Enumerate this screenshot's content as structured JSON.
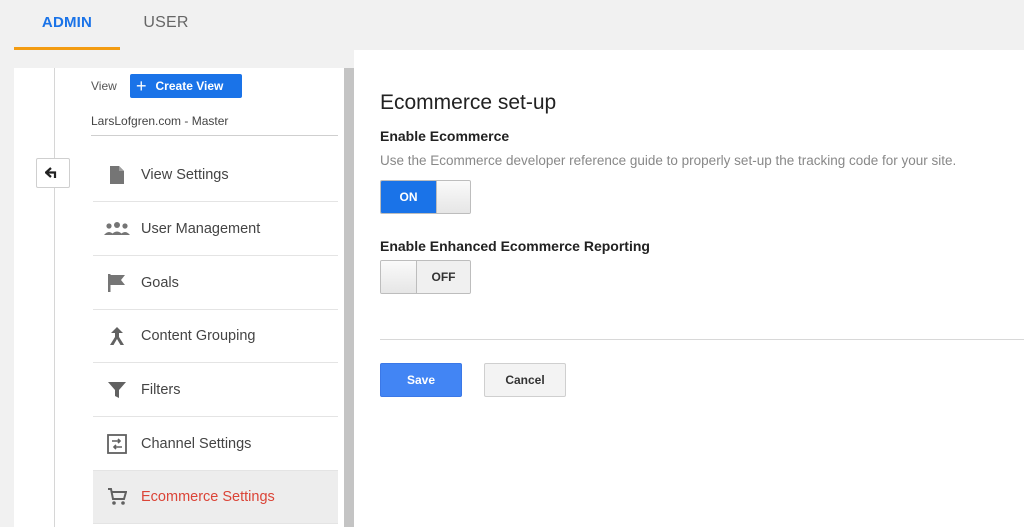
{
  "tabs": [
    {
      "label": "ADMIN",
      "active": true
    },
    {
      "label": "USER",
      "active": false
    }
  ],
  "sidebar": {
    "view_label": "View",
    "create_view_label": "Create View",
    "view_name": "LarsLofgren.com - Master",
    "items": [
      {
        "label": "View Settings",
        "icon": "document-icon"
      },
      {
        "label": "User Management",
        "icon": "users-icon"
      },
      {
        "label": "Goals",
        "icon": "flag-icon"
      },
      {
        "label": "Content Grouping",
        "icon": "content-grouping-icon"
      },
      {
        "label": "Filters",
        "icon": "filter-icon"
      },
      {
        "label": "Channel Settings",
        "icon": "channel-settings-icon"
      },
      {
        "label": "Ecommerce Settings",
        "icon": "cart-icon",
        "active": true
      }
    ]
  },
  "main": {
    "title": "Ecommerce set-up",
    "enable_ecommerce": {
      "heading": "Enable Ecommerce",
      "description": "Use the Ecommerce developer reference guide to properly set-up the tracking code for your site.",
      "toggle_label": "ON",
      "state": "on"
    },
    "enhanced": {
      "heading": "Enable Enhanced Ecommerce Reporting",
      "toggle_label": "OFF",
      "state": "off"
    },
    "save_label": "Save",
    "cancel_label": "Cancel"
  },
  "colors": {
    "accent": "#1a73e8",
    "tab_underline": "#f39c12",
    "active_item": "#db4437"
  }
}
